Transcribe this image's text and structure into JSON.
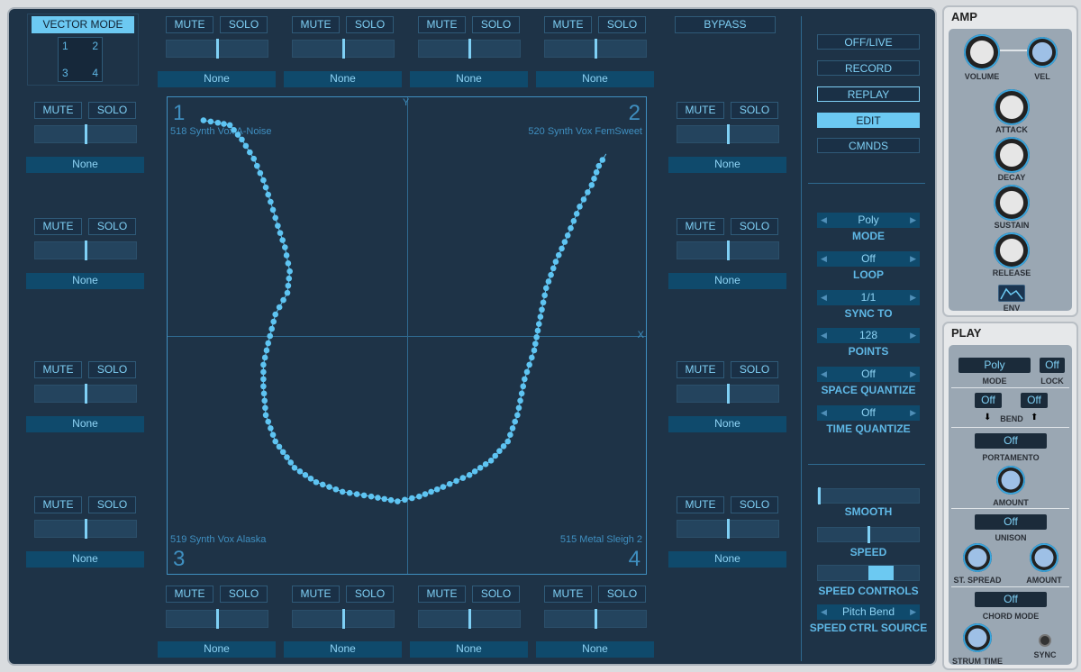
{
  "vector_mode": {
    "label": "VECTOR MODE",
    "corners": [
      "1",
      "2",
      "3",
      "4"
    ]
  },
  "slot": {
    "mute": "MUTE",
    "solo": "SOLO",
    "source": "None"
  },
  "bypass": "BYPASS",
  "pad": {
    "axis_x": "X",
    "axis_y": "Y",
    "corners": [
      {
        "num": "1",
        "name": "518 Synth Vox A-Noise"
      },
      {
        "num": "2",
        "name": "520 Synth Vox FemSweet"
      },
      {
        "num": "3",
        "name": "519 Synth Vox Alaska"
      },
      {
        "num": "4",
        "name": "515 Metal Sleigh 2"
      }
    ],
    "path": [
      [
        -0.85,
        0.9
      ],
      [
        -0.79,
        0.89
      ],
      [
        -0.74,
        0.88
      ],
      [
        -0.69,
        0.82
      ],
      [
        -0.64,
        0.74
      ],
      [
        -0.6,
        0.65
      ],
      [
        -0.57,
        0.56
      ],
      [
        -0.54,
        0.46
      ],
      [
        -0.51,
        0.37
      ],
      [
        -0.49,
        0.27
      ],
      [
        -0.5,
        0.18
      ],
      [
        -0.55,
        0.09
      ],
      [
        -0.58,
        -0.03
      ],
      [
        -0.6,
        -0.12
      ],
      [
        -0.6,
        -0.21
      ],
      [
        -0.59,
        -0.33
      ],
      [
        -0.55,
        -0.44
      ],
      [
        -0.47,
        -0.55
      ],
      [
        -0.38,
        -0.61
      ],
      [
        -0.27,
        -0.65
      ],
      [
        -0.15,
        -0.67
      ],
      [
        -0.04,
        -0.69
      ],
      [
        0.05,
        -0.67
      ],
      [
        0.15,
        -0.63
      ],
      [
        0.26,
        -0.58
      ],
      [
        0.35,
        -0.52
      ],
      [
        0.42,
        -0.44
      ],
      [
        0.46,
        -0.33
      ],
      [
        0.49,
        -0.18
      ],
      [
        0.53,
        -0.06
      ],
      [
        0.55,
        0.05
      ],
      [
        0.58,
        0.2
      ],
      [
        0.62,
        0.31
      ],
      [
        0.67,
        0.42
      ],
      [
        0.72,
        0.54
      ],
      [
        0.77,
        0.63
      ],
      [
        0.8,
        0.71
      ],
      [
        0.83,
        0.76
      ]
    ],
    "path_color": "#5ec4f2"
  },
  "transport": [
    {
      "label": "OFF/LIVE"
    },
    {
      "label": "RECORD"
    },
    {
      "label": "REPLAY",
      "state": "outlined"
    },
    {
      "label": "EDIT",
      "state": "active"
    },
    {
      "label": "CMNDS"
    }
  ],
  "selectors": [
    {
      "value": "Poly",
      "label": "MODE"
    },
    {
      "value": "Off",
      "label": "LOOP"
    },
    {
      "value": "1/1",
      "label": "SYNC TO"
    },
    {
      "value": "128",
      "label": "POINTS"
    },
    {
      "value": "Off",
      "label": "SPACE QUANTIZE"
    },
    {
      "value": "Off",
      "label": "TIME QUANTIZE"
    }
  ],
  "smooth": {
    "label": "SMOOTH",
    "value": 0
  },
  "speed": {
    "label": "SPEED",
    "value": 0.5
  },
  "speed_controls": {
    "label": "SPEED CONTROLS",
    "from": 0.5,
    "to": 0.75
  },
  "speed_ctrl_source": {
    "value": "Pitch Bend",
    "label": "SPEED CTRL SOURCE"
  },
  "amp": {
    "title": "AMP",
    "volume": "VOLUME",
    "vel": "VEL",
    "attack": "ATTACK",
    "decay": "DECAY",
    "sustain": "SUSTAIN",
    "release": "RELEASE",
    "env": "ENV"
  },
  "play": {
    "title": "PLAY",
    "mode_value": "Poly",
    "mode": "MODE",
    "lock_value": "Off",
    "lock": "LOCK",
    "bend_down": "Off",
    "bend_up": "Off",
    "bend": "BEND",
    "portamento_value": "Off",
    "portamento": "PORTAMENTO",
    "amount": "AMOUNT",
    "unison_value": "Off",
    "unison": "UNISON",
    "st_spread": "ST. SPREAD",
    "amount2": "AMOUNT",
    "chord_value": "Off",
    "chord_mode": "CHORD MODE",
    "strum_time": "STRUM TIME",
    "sync": "SYNC"
  },
  "colors": {
    "accent": "#6cc9f2",
    "background": "#1e3347"
  }
}
